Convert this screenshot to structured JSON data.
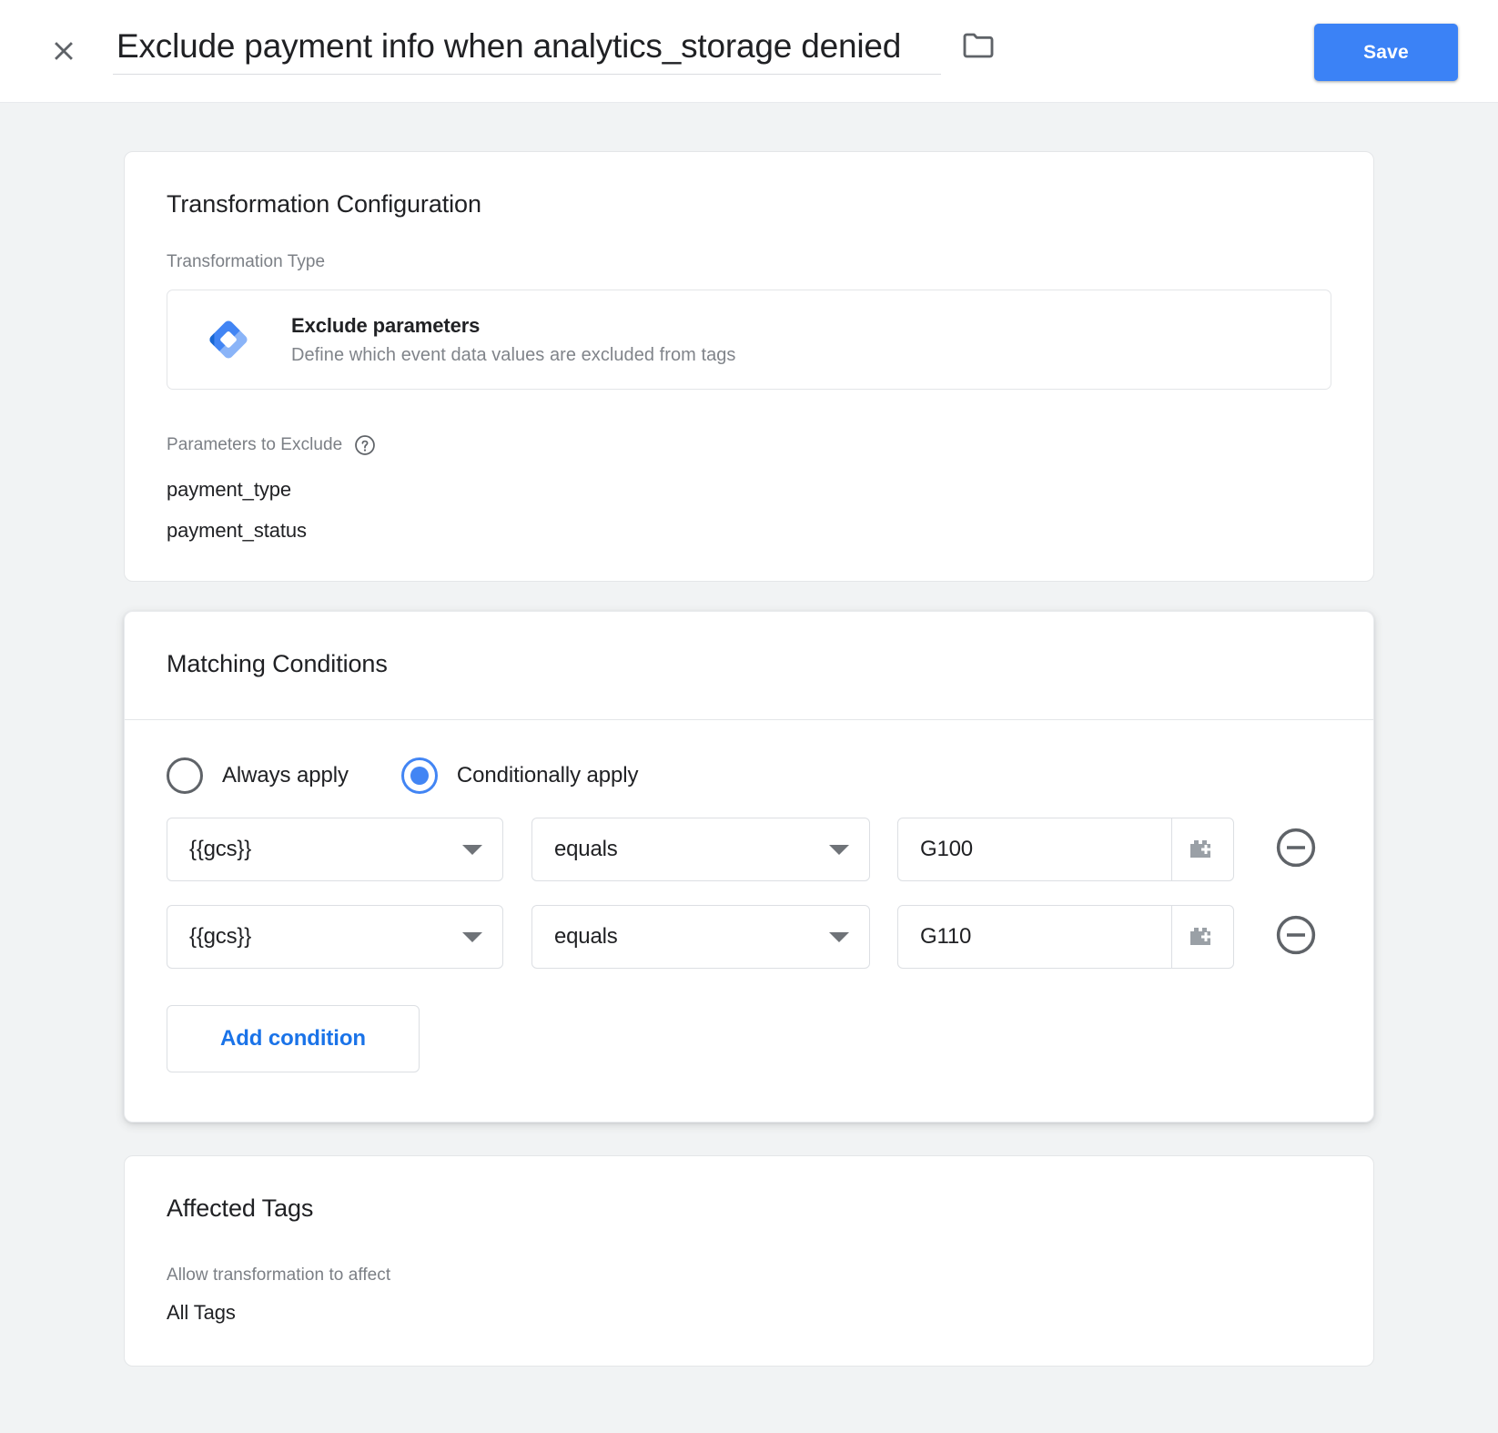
{
  "header": {
    "close_icon": "close-icon",
    "title_value": "Exclude payment info when analytics_storage denied",
    "title_placeholder": "Untitled Transformation",
    "folder_icon": "folder-icon",
    "save_label": "Save",
    "save_color": "#3b82f6"
  },
  "transformation_card": {
    "title": "Transformation Configuration",
    "type_label": "Transformation Type",
    "type_tile": {
      "icon": "gtm-diamond-icon",
      "name": "Exclude parameters",
      "description": "Define which event data values are excluded from tags"
    },
    "params_label": "Parameters to Exclude",
    "help_icon": "help-icon",
    "params": [
      "payment_type",
      "payment_status"
    ]
  },
  "conditions_card": {
    "title": "Matching Conditions",
    "modes": [
      {
        "label": "Always apply",
        "selected": false
      },
      {
        "label": "Conditionally apply",
        "selected": true
      }
    ],
    "selected_color": "#4285f4",
    "rows": [
      {
        "variable": "{{gcs}}",
        "operator": "equals",
        "value": "G100",
        "picker_icon": "variable-picker-icon",
        "remove_icon": "remove-circle-icon"
      },
      {
        "variable": "{{gcs}}",
        "operator": "equals",
        "value": "G110",
        "picker_icon": "variable-picker-icon",
        "remove_icon": "remove-circle-icon"
      }
    ],
    "value_placeholder": "Value",
    "add_condition_label": "Add condition",
    "add_condition_color": "#1a73e8"
  },
  "tags_card": {
    "title": "Affected Tags",
    "sub_label": "Allow transformation to affect",
    "value": "All Tags"
  }
}
